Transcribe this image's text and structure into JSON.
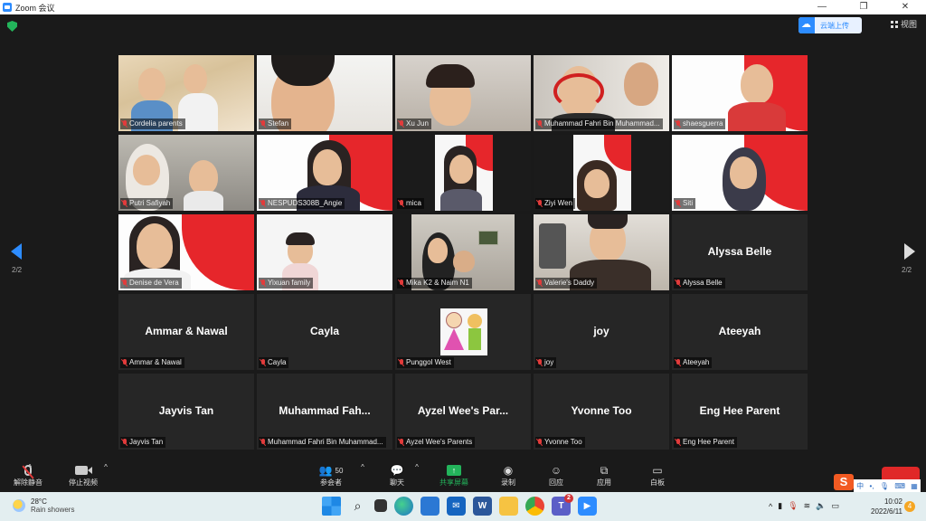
{
  "window": {
    "title": "Zoom 会议"
  },
  "header": {
    "cloud_record_label": "云端上传",
    "view_label": "视图"
  },
  "pagination": {
    "left": "2/2",
    "right": "2/2"
  },
  "participants": [
    {
      "name": "Cordelia parents",
      "video": true
    },
    {
      "name": "Stefan",
      "video": true
    },
    {
      "name": "Xu Jun",
      "video": true
    },
    {
      "name": "Muhammad Fahri Bin Muhammad...",
      "video": true
    },
    {
      "name": "shaesguerra",
      "video": true
    },
    {
      "name": "Putri Safiyah",
      "video": true
    },
    {
      "name": "NESPUDS308B_Angie",
      "video": true
    },
    {
      "name": "mica",
      "video": true
    },
    {
      "name": "Ziyi Wen",
      "video": true
    },
    {
      "name": "Siti",
      "video": true
    },
    {
      "name": "Denise de Vera",
      "video": true
    },
    {
      "name": "Yixuan family",
      "video": true
    },
    {
      "name": "Mika K2 & Naim N1",
      "video": true
    },
    {
      "name": "Valerie's Daddy",
      "video": true
    },
    {
      "name": "Alyssa Belle",
      "big_name": "Alyssa Belle",
      "video": false
    },
    {
      "name": "Ammar & Nawal",
      "big_name": "Ammar & Nawal",
      "video": false
    },
    {
      "name": "Cayla",
      "big_name": "Cayla",
      "video": false
    },
    {
      "name": "Punggol West",
      "video": false,
      "logo": true
    },
    {
      "name": "joy",
      "big_name": "joy",
      "video": false
    },
    {
      "name": "Ateeyah",
      "big_name": "Ateeyah",
      "video": false
    },
    {
      "name": "Jayvis Tan",
      "big_name": "Jayvis Tan",
      "video": false
    },
    {
      "name": "Muhammad Fahri Bin Muhammad...",
      "big_name": "Muhammad  Fah...",
      "video": false
    },
    {
      "name": "Ayzel Wee's Parents",
      "big_name": "Ayzel Wee's Par...",
      "video": false
    },
    {
      "name": "Yvonne Too",
      "big_name": "Yvonne Too",
      "video": false
    },
    {
      "name": "Eng Hee Parent",
      "big_name": "Eng Hee Parent",
      "video": false
    }
  ],
  "toolbar": {
    "unmute": "解除静音",
    "stop_video": "停止视频",
    "participants": "参会者",
    "participant_count": "50",
    "chat": "聊天",
    "share_screen": "共享屏幕",
    "record": "录制",
    "reactions": "回应",
    "apps": "应用",
    "whiteboard": "白板"
  },
  "taskbar": {
    "weather_temp": "28°C",
    "weather_desc": "Rain showers",
    "time": "10:02",
    "date": "2022/6/11",
    "notifications": "4",
    "teams_badge": "2",
    "ime_logo": "S",
    "ime_lang": "中"
  },
  "colors": {
    "accent": "#2d8cff",
    "share_green": "#23b45b",
    "muted_red": "#e23b3b",
    "end_red": "#e02828"
  }
}
